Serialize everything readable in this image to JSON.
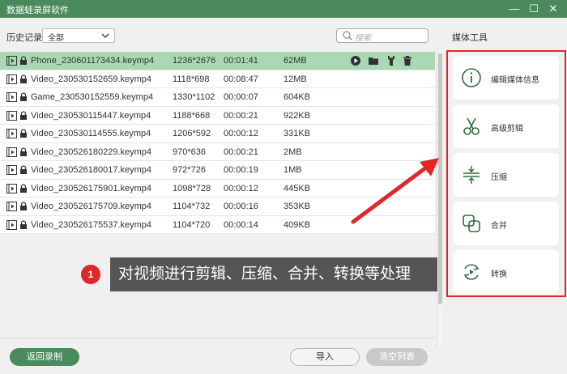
{
  "window": {
    "title": "数据蛙录屏软件",
    "min_glyph": "—",
    "max_glyph": "☐",
    "close_glyph": "✕"
  },
  "history": {
    "label": "历史记录",
    "filter_value": "全部",
    "search_placeholder": "搜索"
  },
  "files": [
    {
      "name": "Phone_230601173434.keymp4",
      "res": "1236*2676",
      "dur": "00:01:41",
      "size": "62MB",
      "selected": true
    },
    {
      "name": "Video_230530152659.keymp4",
      "res": "1118*698",
      "dur": "00:08:47",
      "size": "12MB"
    },
    {
      "name": "Game_230530152559.keymp4",
      "res": "1330*1102",
      "dur": "00:00:07",
      "size": "604KB"
    },
    {
      "name": "Video_230530115447.keymp4",
      "res": "1188*668",
      "dur": "00:00:21",
      "size": "922KB"
    },
    {
      "name": "Video_230530114555.keymp4",
      "res": "1206*592",
      "dur": "00:00:12",
      "size": "331KB"
    },
    {
      "name": "Video_230526180229.keymp4",
      "res": "970*636",
      "dur": "00:00:21",
      "size": "2MB"
    },
    {
      "name": "Video_230526180017.keymp4",
      "res": "972*726",
      "dur": "00:00:19",
      "size": "1MB"
    },
    {
      "name": "Video_230526175901.keymp4",
      "res": "1098*728",
      "dur": "00:00:12",
      "size": "445KB"
    },
    {
      "name": "Video_230526175709.keymp4",
      "res": "1104*732",
      "dur": "00:00:16",
      "size": "353KB"
    },
    {
      "name": "Video_230526175537.keymp4",
      "res": "1104*720",
      "dur": "00:00:14",
      "size": "409KB"
    }
  ],
  "buttons": {
    "back": "返回录制",
    "import": "导入",
    "clear": "清空列表"
  },
  "media_tools": {
    "title": "媒体工具",
    "items": [
      {
        "label": "编辑媒体信息",
        "icon": "info-icon"
      },
      {
        "label": "高级剪辑",
        "icon": "scissors-icon"
      },
      {
        "label": "压缩",
        "icon": "compress-icon"
      },
      {
        "label": "合并",
        "icon": "merge-icon"
      },
      {
        "label": "转换",
        "icon": "convert-icon"
      }
    ]
  },
  "annotation": {
    "number": "1",
    "text": "对视频进行剪辑、压缩、合并、转换等处理"
  },
  "colors": {
    "accent": "#4a8a5c",
    "selected_row": "#a9d8b3",
    "highlight_red": "#e02828"
  }
}
